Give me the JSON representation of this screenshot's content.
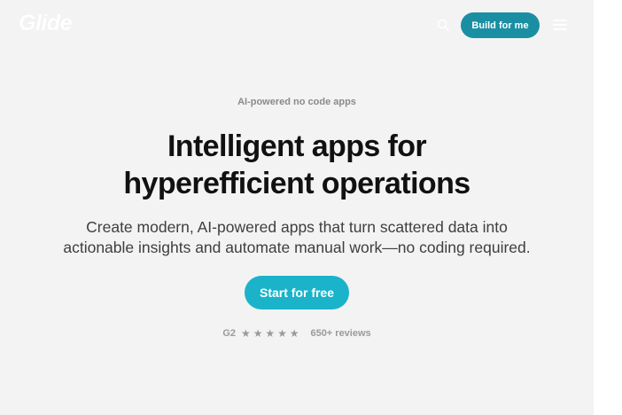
{
  "header": {
    "logo": "Glide",
    "build_button": "Build for me",
    "search_icon": "search-icon",
    "menu_icon": "hamburger-menu-icon"
  },
  "hero": {
    "eyebrow": "AI-powered no code apps",
    "headline_line1": "Intelligent apps for",
    "headline_line2": "hyperefficient operations",
    "subhead_line1": "Create modern, AI-powered apps that turn scattered data into",
    "subhead_line2": "actionable insights and automate manual work—no coding required.",
    "cta": "Start for free"
  },
  "reviews": {
    "source": "G2",
    "rating_stars": 5,
    "count": "650+ reviews"
  },
  "colors": {
    "page_bg": "#f3f3f3",
    "build_button_bg": "#1a8fa3",
    "cta_bg": "#1ab3c9",
    "headline": "#111111",
    "muted": "#8a8a8a"
  }
}
